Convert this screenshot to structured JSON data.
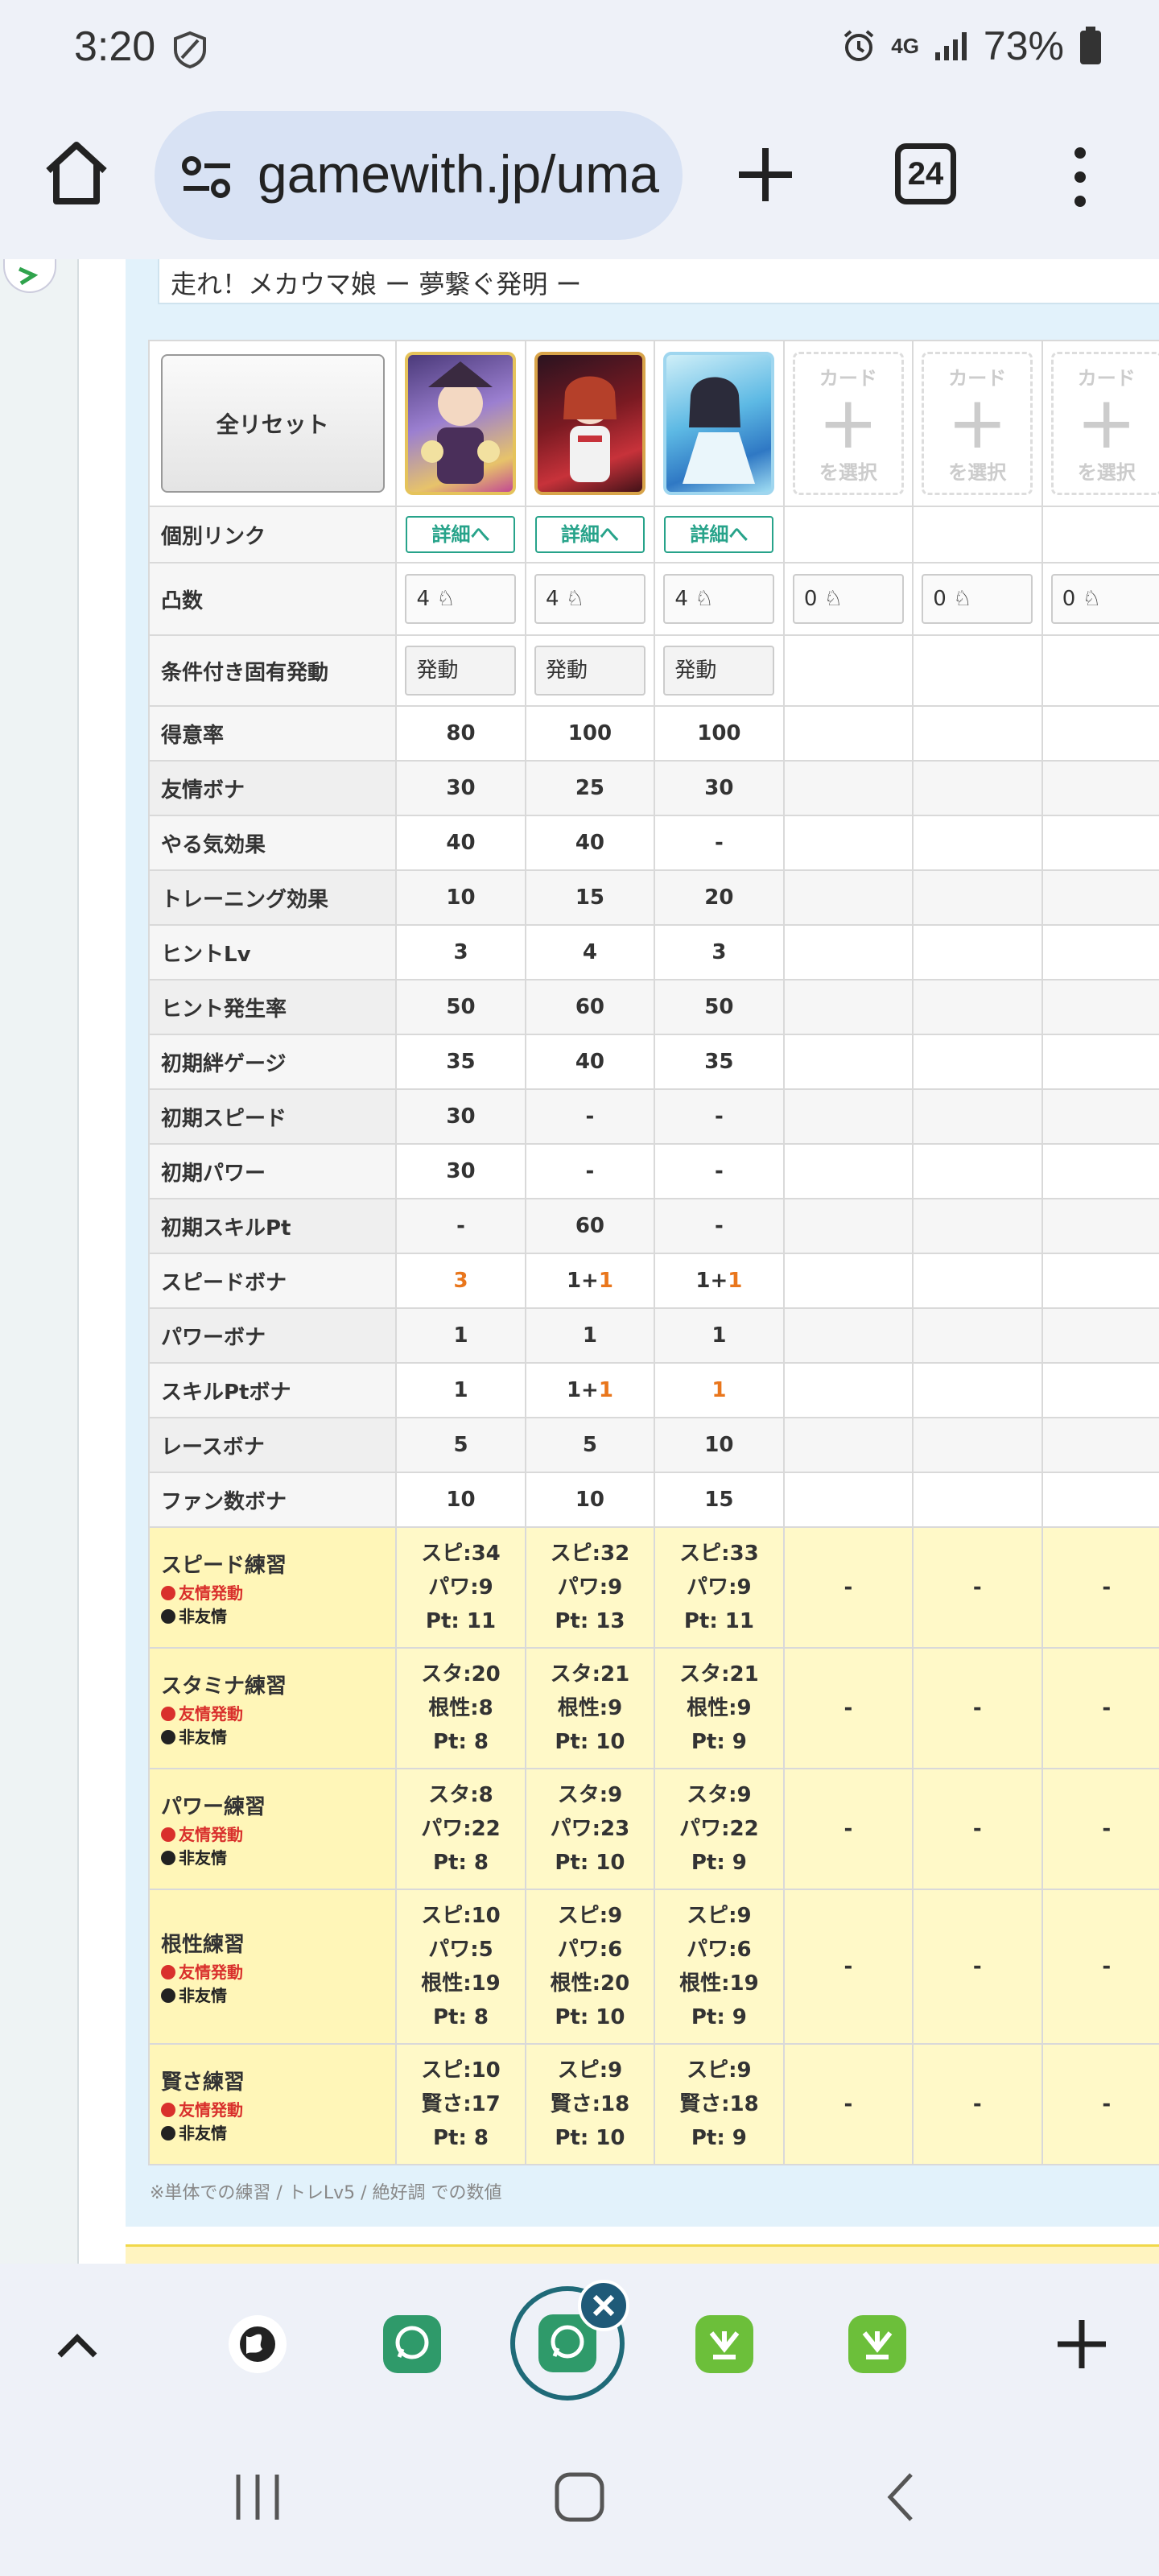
{
  "status": {
    "time": "3:20",
    "network": "4G",
    "battery": "73%"
  },
  "browser": {
    "url": "gamewith.jp/uma",
    "tab_count": "24"
  },
  "page": {
    "title": "走れ！メカウマ娘 ー 夢繋ぐ発明 ー",
    "reset_label": "全リセット",
    "empty_card_top": "カード",
    "empty_card_bottom": "を選択",
    "detail_label": "詳細へ",
    "trigger_label": "発動",
    "limit_break": [
      "4",
      "4",
      "4",
      "0",
      "0",
      "0"
    ],
    "note": "※単体での練習 / トレLv5 / 絶好調 での数値"
  },
  "row_labels": {
    "link": "個別リンク",
    "limit": "凸数",
    "trigger": "条件付き固有発動"
  },
  "stats": [
    {
      "label": "得意率",
      "v": [
        "80",
        "100",
        "100"
      ]
    },
    {
      "label": "友情ボナ",
      "v": [
        "30",
        "25",
        "30"
      ]
    },
    {
      "label": "やる気効果",
      "v": [
        "40",
        "40",
        "-"
      ]
    },
    {
      "label": "トレーニング効果",
      "v": [
        "10",
        "15",
        "20"
      ]
    },
    {
      "label": "ヒントLv",
      "v": [
        "3",
        "4",
        "3"
      ]
    },
    {
      "label": "ヒント発生率",
      "v": [
        "50",
        "60",
        "50"
      ]
    },
    {
      "label": "初期絆ゲージ",
      "v": [
        "35",
        "40",
        "35"
      ]
    },
    {
      "label": "初期スピード",
      "v": [
        "30",
        "-",
        "-"
      ]
    },
    {
      "label": "初期パワー",
      "v": [
        "30",
        "-",
        "-"
      ]
    },
    {
      "label": "初期スキルPt",
      "v": [
        "-",
        "60",
        "-"
      ]
    },
    {
      "label": "スピードボナ",
      "v": [
        "",
        "1+",
        "1+"
      ],
      "o": [
        "3",
        "1",
        "1"
      ]
    },
    {
      "label": "パワーボナ",
      "v": [
        "1",
        "1",
        "1"
      ]
    },
    {
      "label": "スキルPtボナ",
      "v": [
        "1",
        "1+",
        ""
      ],
      "o": [
        "",
        "1",
        "1"
      ]
    },
    {
      "label": "レースボナ",
      "v": [
        "5",
        "5",
        "10"
      ]
    },
    {
      "label": "ファン数ボナ",
      "v": [
        "10",
        "10",
        "15"
      ]
    }
  ],
  "training_legend": {
    "friend": "友情発動",
    "nonfriend": "非友情"
  },
  "training": [
    {
      "label": "スピード練習",
      "red": true,
      "cols": [
        [
          "スピ:34",
          "パワ:9",
          "Pt: 11"
        ],
        [
          "スピ:32",
          "パワ:9",
          "Pt: 13"
        ],
        [
          "スピ:33",
          "パワ:9",
          "Pt: 11"
        ]
      ]
    },
    {
      "label": "スタミナ練習",
      "red": false,
      "cols": [
        [
          "スタ:20",
          "根性:8",
          "Pt: 8"
        ],
        [
          "スタ:21",
          "根性:9",
          "Pt: 10"
        ],
        [
          "スタ:21",
          "根性:9",
          "Pt: 9"
        ]
      ]
    },
    {
      "label": "パワー練習",
      "red": false,
      "cols": [
        [
          "スタ:8",
          "パワ:22",
          "Pt: 8"
        ],
        [
          "スタ:9",
          "パワ:23",
          "Pt: 10"
        ],
        [
          "スタ:9",
          "パワ:22",
          "Pt: 9"
        ]
      ]
    },
    {
      "label": "根性練習",
      "red": false,
      "cols": [
        [
          "スピ:10",
          "パワ:5",
          "根性:19",
          "Pt: 8"
        ],
        [
          "スピ:9",
          "パワ:6",
          "根性:20",
          "Pt: 10"
        ],
        [
          "スピ:9",
          "パワ:6",
          "根性:19",
          "Pt: 9"
        ]
      ]
    },
    {
      "label": "賢さ練習",
      "red": false,
      "cols": [
        [
          "スピ:10",
          "賢さ:17",
          "Pt: 8"
        ],
        [
          "スピ:9",
          "賢さ:18",
          "Pt: 10"
        ],
        [
          "スピ:9",
          "賢さ:18",
          "Pt: 9"
        ]
      ]
    }
  ],
  "empty_dash": "-",
  "colors": {
    "link_green": "#27a38a",
    "training_bg": "#fff9c8",
    "accent_red": "#e0302a",
    "accent_orange": "#e9761c"
  }
}
